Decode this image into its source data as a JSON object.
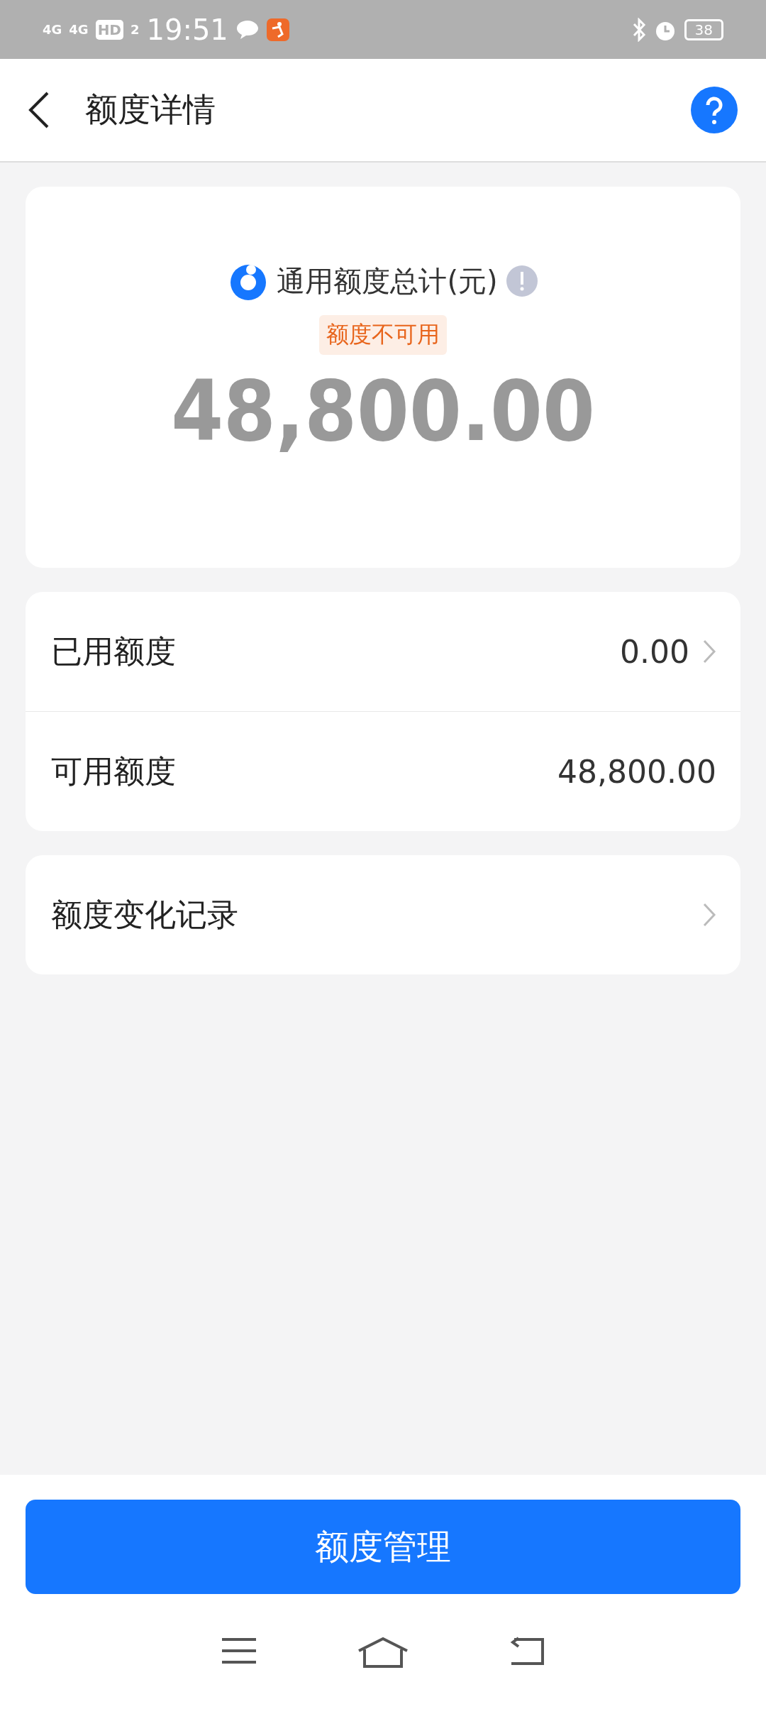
{
  "status_bar": {
    "signals": [
      "4G",
      "4G"
    ],
    "hd": "HD",
    "hd_sub": "2",
    "time": "19:51",
    "battery": "38"
  },
  "header": {
    "title": "额度详情"
  },
  "summary": {
    "label": "通用额度总计(元)",
    "badge": "额度不可用",
    "amount": "48,800.00"
  },
  "rows": [
    {
      "label": "已用额度",
      "value": "0.00",
      "chevron": true
    },
    {
      "label": "可用额度",
      "value": "48,800.00",
      "chevron": false
    }
  ],
  "record": {
    "label": "额度变化记录"
  },
  "primary_button": "额度管理"
}
